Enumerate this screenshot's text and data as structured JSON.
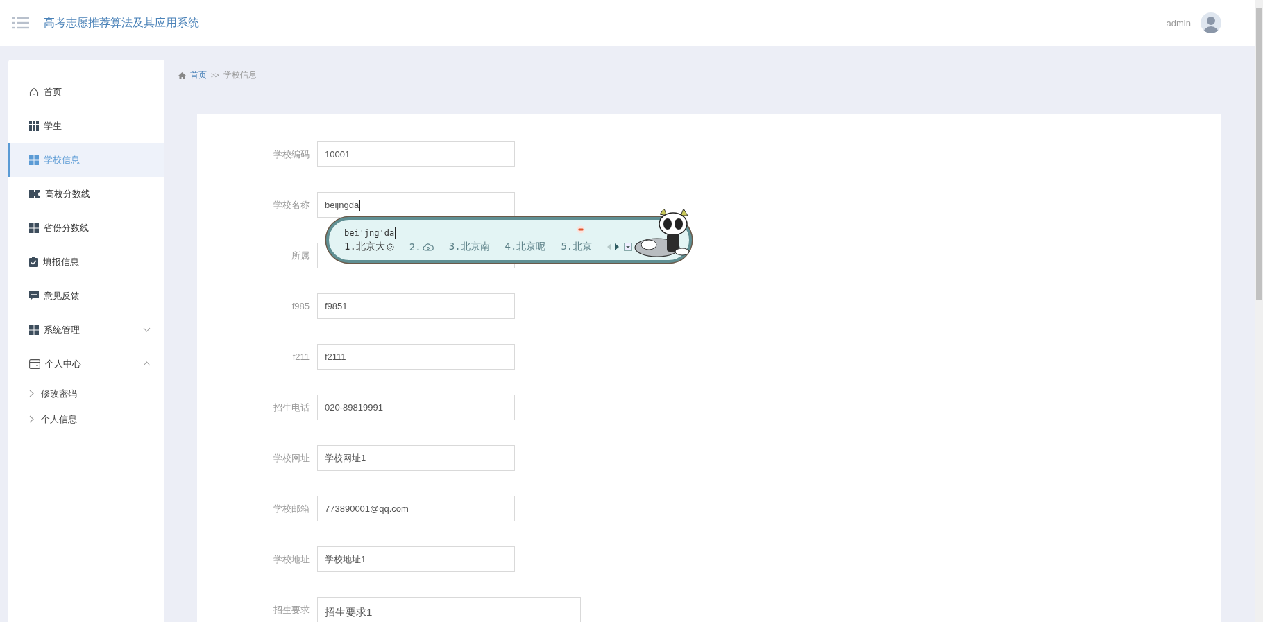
{
  "header": {
    "title": "高考志愿推荐算法及其应用系统",
    "user": "admin"
  },
  "sidebar": {
    "items": [
      {
        "label": "首页",
        "selected": false
      },
      {
        "label": "学生",
        "selected": false
      },
      {
        "label": "学校信息",
        "selected": true
      },
      {
        "label": "高校分数线",
        "selected": false
      },
      {
        "label": "省份分数线",
        "selected": false
      },
      {
        "label": "填报信息",
        "selected": false
      },
      {
        "label": "意见反馈",
        "selected": false
      },
      {
        "label": "系统管理",
        "selected": false,
        "expanded": false
      },
      {
        "label": "个人中心",
        "selected": false,
        "expanded": true,
        "children": [
          {
            "label": "修改密码"
          },
          {
            "label": "个人信息"
          }
        ]
      }
    ]
  },
  "breadcrumb": {
    "home": "首页",
    "separator": ">>",
    "current": "学校信息"
  },
  "form": {
    "fields": [
      {
        "label": "学校编码",
        "value": "10001",
        "kind": "input"
      },
      {
        "label": "学校名称",
        "value": "beijngda",
        "kind": "input",
        "focused": true
      },
      {
        "label": "所属",
        "kind": "input"
      },
      {
        "label": "f985",
        "value": "f9851",
        "kind": "input"
      },
      {
        "label": "f211",
        "value": "f2111",
        "kind": "input"
      },
      {
        "label": "招生电话",
        "value": "020-89819991",
        "kind": "input"
      },
      {
        "label": "学校网址",
        "value": "学校网址1",
        "kind": "input"
      },
      {
        "label": "学校邮箱",
        "value": "773890001@qq.com",
        "kind": "input"
      },
      {
        "label": "学校地址",
        "value": "学校地址1",
        "kind": "input"
      },
      {
        "label": "招生要求",
        "value": "招生要求1",
        "kind": "textarea"
      }
    ]
  },
  "ime": {
    "composition": "bei'jng'da",
    "candidates": [
      {
        "index": "1.",
        "text": "北京大",
        "kind": "text",
        "selected": true
      },
      {
        "index": "2.",
        "kind": "cloud",
        "selected": false
      },
      {
        "index": "3.",
        "text": "北京南",
        "kind": "text",
        "selected": false
      },
      {
        "index": "4.",
        "text": "北京呢",
        "kind": "text",
        "selected": false
      },
      {
        "index": "5.",
        "text": "北京",
        "kind": "text",
        "selected": false
      }
    ]
  }
}
